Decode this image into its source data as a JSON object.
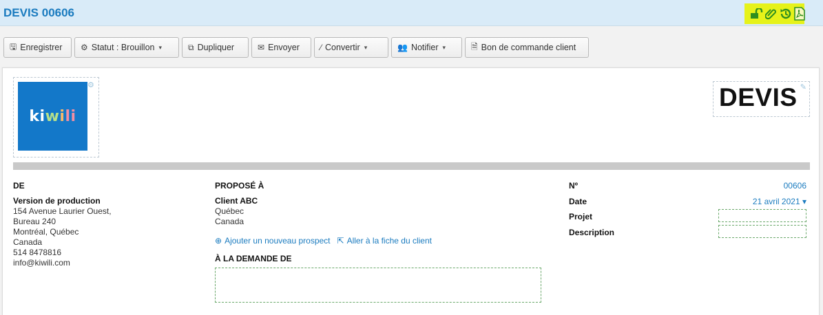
{
  "window": {
    "title": "DEVIS 00606",
    "icons": [
      "unlock-icon",
      "paperclip-icon",
      "history-icon",
      "pdf-icon"
    ],
    "icon_highlight_color": "#e6f21a",
    "accent_color": "#1a7bbf"
  },
  "toolbar": {
    "save": "Enregistrer",
    "status": "Statut : Brouillon",
    "duplicate": "Dupliquer",
    "send": "Envoyer",
    "convert": "Convertir",
    "notify": "Notifier",
    "purchase_order": "Bon de commande client"
  },
  "document": {
    "logo_text": {
      "a": "ki",
      "b": "w",
      "c": "i",
      "d": "li"
    },
    "type_label": "DEVIS",
    "from": {
      "heading": "DE",
      "name": "Version de production",
      "lines": [
        "154 Avenue Laurier Ouest,",
        "Bureau 240",
        "Montréal, Québec",
        "Canada",
        "514 8478816",
        "info@kiwili.com"
      ]
    },
    "to": {
      "heading": "PROPOSÉ À",
      "client": "Client ABC",
      "lines": [
        "Québec",
        "Canada"
      ],
      "add_prospect": "Ajouter un nouveau prospect",
      "goto_client": "Aller à la fiche du client",
      "requested_by_heading": "À LA DEMANDE DE",
      "requested_by": ""
    },
    "meta": {
      "number_label": "Nº",
      "number": "00606",
      "date_label": "Date",
      "date": "21 avril 2021",
      "project_label": "Projet",
      "project": "",
      "description_label": "Description",
      "description": ""
    }
  }
}
